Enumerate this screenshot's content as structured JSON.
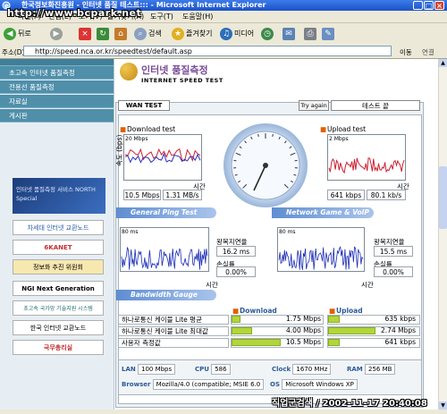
{
  "window": {
    "title": "한국정보화진흥원 - 인터넷 품질 테스트::: - Microsoft Internet Explorer",
    "watermark": "http://www.bcpark.net"
  },
  "menu": [
    "파일(F)",
    "편집(E)",
    "보기(V)",
    "즐겨찾기(A)",
    "도구(T)",
    "도움말(H)"
  ],
  "toolbar": {
    "back": "뒤로",
    "search": "검색",
    "favorites": "즐겨찾기",
    "media": "미디어"
  },
  "address": {
    "label": "주소(D)",
    "url": "http://speed.nca.or.kr/speedtest/default.asp",
    "go": "이동",
    "links": "연결"
  },
  "sidebar": {
    "items": [
      "초고속 인터넷 품질측정",
      "전용선 품질측정",
      "자료실",
      "게시판"
    ],
    "promo": "인터넷 품질측정 서비스 NORTH Special",
    "banners": [
      "차세대 인터넷 교환노드",
      "6KANET",
      "정보화 추진 위원회",
      "NGI Next Generation",
      "초고속 국가망 기술지원 시스템",
      "한국 인터넷 교환노드",
      "국무총리실"
    ]
  },
  "header": {
    "title": "인터넷 품질측정",
    "subtitle": "INTERNET SPEED TEST"
  },
  "tabs": {
    "wan": "WAN TEST",
    "retry": "Try again",
    "active": "테스트 끝"
  },
  "download": {
    "label": "Download test",
    "scale": "20 Mbps",
    "axis_y": "속도 (bps)",
    "axis_x": "시간",
    "mbps": "10.5 Mbps",
    "mbs": "1.31 MB/s"
  },
  "upload": {
    "label": "Upload test",
    "scale": "2 Mbps",
    "axis_y": "속도 (bps)",
    "axis_x": "시간",
    "kbps": "641 kbps",
    "kbs": "80.1 kb/s"
  },
  "ping": {
    "title": "General Ping Test",
    "scale": "80 ms",
    "axis_y": "지연(ms)",
    "axis_x": "시간",
    "rtt_label": "왕복지연율",
    "rtt": "16.2 ms",
    "loss_label": "손실률",
    "loss": "0.00%"
  },
  "game": {
    "title": "Network Game & VoIP Test",
    "scale": "80 ms",
    "axis_y": "지연(ms)",
    "axis_x": "시간",
    "rtt_label": "왕복지연율",
    "rtt": "15.5 ms",
    "loss_label": "손실률",
    "loss": "0.00%"
  },
  "gauge": {
    "title": "Bandwidth Gauge",
    "download_header": "Download",
    "upload_header": "Upload",
    "rows": [
      {
        "label": "하나로통신 케이블 Lite 평균",
        "down": "1.75 Mbps",
        "down_pct": 0.17,
        "up": "635 kbps",
        "up_pct": 0.23
      },
      {
        "label": "하나로통신 케이블 Lite 최대값",
        "down": "4.00 Mbps",
        "down_pct": 0.4,
        "up": "2.74 Mbps",
        "up_pct": 0.95
      },
      {
        "label": "사용자 측정값",
        "down": "10.5 Mbps",
        "down_pct": 0.95,
        "up": "641 kbps",
        "up_pct": 0.23
      }
    ]
  },
  "specs": {
    "lan_label": "LAN",
    "lan": "100 Mbps",
    "cpu_label": "CPU",
    "cpu": "586",
    "clock_label": "Clock",
    "clock": "1670 MHz",
    "ram_label": "RAM",
    "ram": "256 MB",
    "browser_label": "Browser",
    "browser": "Mozilla/4.0 (compatible; MSIE 6.0",
    "os_label": "OS",
    "os": "Microsoft Windows XP"
  },
  "stamp": "직업군검색 / 2002-11-17 20:40:08",
  "colors": {
    "titlebar": "#1b52c9",
    "sidebar_nav": "#4f8faa",
    "section_bar": "#5e8dd1",
    "gauge_bar": "#b2d63a",
    "download_line": "#cc2233",
    "ping_line": "#1b2db5"
  }
}
